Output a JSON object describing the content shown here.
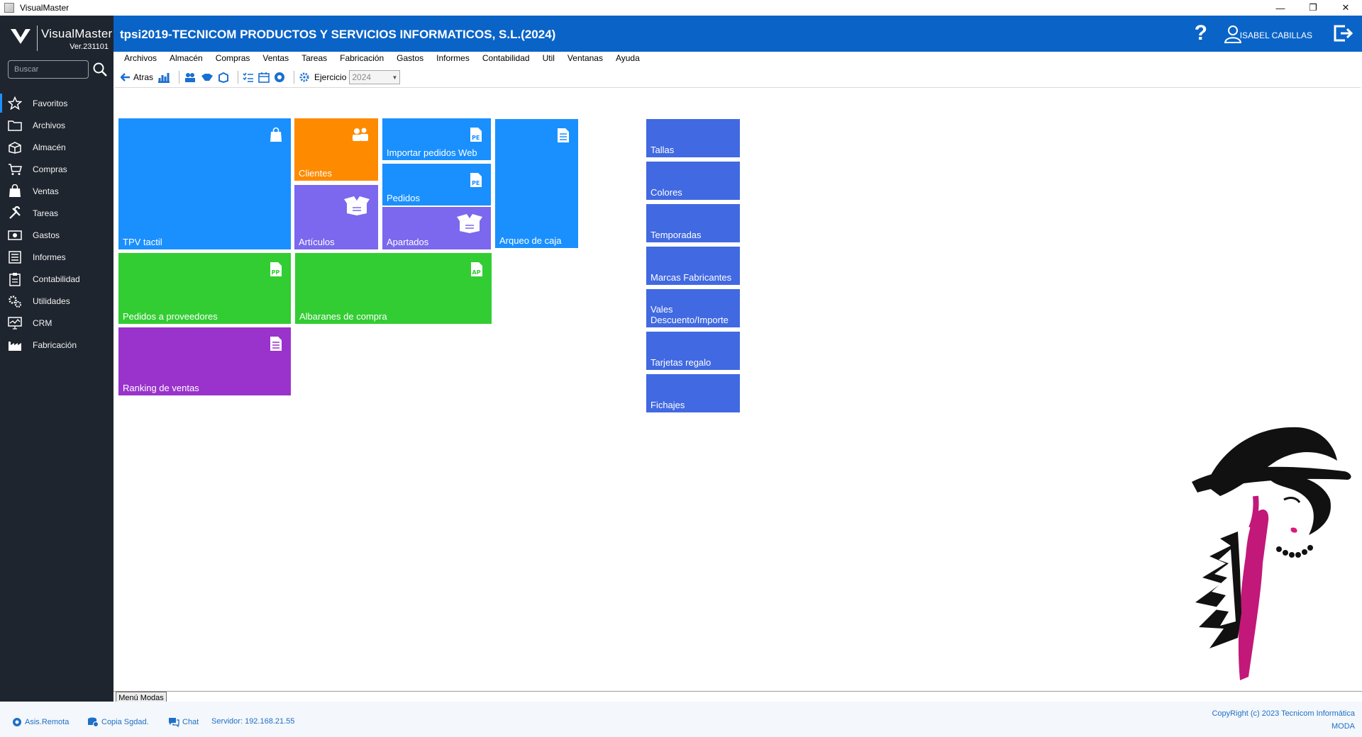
{
  "window": {
    "title": "VisualMaster"
  },
  "brand": {
    "name": "VisualMaster",
    "version": "Ver.231101"
  },
  "search": {
    "placeholder": "Buscar"
  },
  "sidebar": {
    "items": [
      {
        "label": "Favoritos",
        "icon": "star-icon"
      },
      {
        "label": "Archivos",
        "icon": "folder-icon"
      },
      {
        "label": "Almacén",
        "icon": "box-icon"
      },
      {
        "label": "Compras",
        "icon": "cart-icon"
      },
      {
        "label": "Ventas",
        "icon": "shopping-bag-icon"
      },
      {
        "label": "Tareas",
        "icon": "tools-icon"
      },
      {
        "label": "Gastos",
        "icon": "money-icon"
      },
      {
        "label": "Informes",
        "icon": "report-icon"
      },
      {
        "label": "Contabilidad",
        "icon": "clipboard-icon"
      },
      {
        "label": "Utilidades",
        "icon": "gears-icon"
      },
      {
        "label": "CRM",
        "icon": "monitor-icon"
      },
      {
        "label": "Fabricación",
        "icon": "factory-icon"
      }
    ]
  },
  "header": {
    "title": "tpsi2019-TECNICOM PRODUCTOS Y SERVICIOS INFORMATICOS, S.L.(2024)",
    "help": "?",
    "user": "ISABEL CABILLAS"
  },
  "menu": [
    "Archivos",
    "Almacén",
    "Compras",
    "Ventas",
    "Tareas",
    "Fabricación",
    "Gastos",
    "Informes",
    "Contabilidad",
    "Util",
    "Ventanas",
    "Ayuda"
  ],
  "toolbar": {
    "back_label": "Atras",
    "ejercicio_label": "Ejercicio",
    "ejercicio_value": "2024"
  },
  "tiles": {
    "tpv": "TPV tactil",
    "clientes": "Clientes",
    "articulos": "Artículos",
    "importar": "Importar pedidos Web",
    "pedidos": "Pedidos",
    "apartados": "Apartados",
    "arqueo": "Arqueo de caja",
    "pedidos_prov": "Pedidos a proveedores",
    "albaranes": "Albaranes de compra",
    "ranking": "Ranking de ventas",
    "tallas": "Tallas",
    "colores": "Colores",
    "temporadas": "Temporadas",
    "marcas": "Marcas Fabricantes",
    "vales_1": "Vales",
    "vales_2": "Descuento/Importe",
    "tarjetas": "Tarjetas regalo",
    "fichajes": "Fichajes"
  },
  "tab": {
    "label": "Menú Modas"
  },
  "status": {
    "asis": "Asis.Remota",
    "copia": "Copia Sgdad.",
    "chat": "Chat",
    "servidor": "Servidor: 192.168.21.55",
    "copyright": "CopyRight (c) 2023 Tecnicom Informática",
    "mode": "MODA"
  },
  "colors": {
    "header": "#0a64c8",
    "sidebar": "#1f252e",
    "tile_blue": "#1a90ff",
    "tile_orange": "#fe8a00",
    "tile_purple": "#7b68ee",
    "tile_green": "#32cd32",
    "tile_violet": "#9933cc",
    "tile_royal": "#4169e1"
  }
}
